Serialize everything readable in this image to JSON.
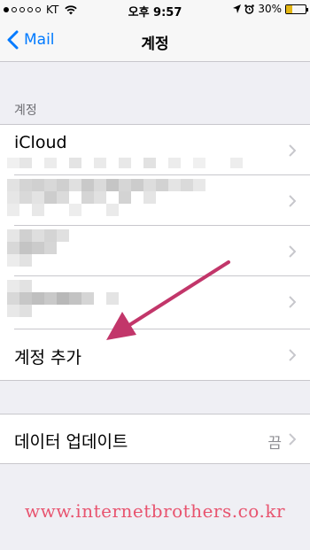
{
  "status_bar": {
    "carrier": "KT",
    "time": "오후 9:57",
    "battery": "30%",
    "battery_level": 0.3,
    "battery_color": "#e3b614"
  },
  "nav": {
    "back_label": "Mail",
    "title": "계정"
  },
  "accounts_section": {
    "header": "계정",
    "icloud_label": "iCloud",
    "add_account_label": "계정 추가"
  },
  "fetch_section": {
    "label": "데이터 업데이트",
    "value": "끔"
  },
  "watermark": "www.internetbrothers.co.kr",
  "colors": {
    "accent": "#007aff",
    "arrow": "#c2366a",
    "watermark": "#e8546f"
  },
  "icons": [
    "wifi-icon",
    "location-icon",
    "alarm-icon",
    "battery-icon",
    "chevron-left-icon",
    "chevron-right-icon"
  ]
}
